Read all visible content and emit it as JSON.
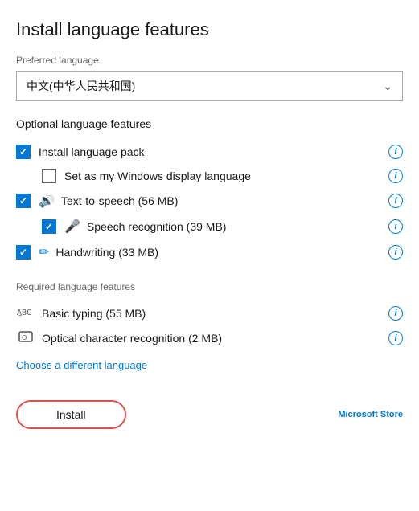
{
  "page": {
    "title": "Install language features"
  },
  "preferred": {
    "label": "Preferred language",
    "selected": "中文(中华人民共和国)",
    "dropdown_placeholder": "中文(中华人民共和国)"
  },
  "optional": {
    "section_title": "Optional language features",
    "items": [
      {
        "id": "install-pack",
        "label": "Install language pack",
        "checked": true,
        "icon": null,
        "level": 0
      },
      {
        "id": "windows-display",
        "label": "Set as my Windows display language",
        "checked": false,
        "icon": null,
        "level": 1
      },
      {
        "id": "text-to-speech",
        "label": "Text-to-speech (56 MB)",
        "checked": true,
        "icon": "tts",
        "level": 0
      },
      {
        "id": "speech-recognition",
        "label": "Speech recognition (39 MB)",
        "checked": true,
        "icon": "mic",
        "level": 1
      },
      {
        "id": "handwriting",
        "label": "Handwriting (33 MB)",
        "checked": true,
        "icon": "pen",
        "level": 0
      }
    ]
  },
  "required": {
    "section_title": "Required language features",
    "items": [
      {
        "id": "basic-typing",
        "label": "Basic typing (55 MB)",
        "icon": "abc"
      },
      {
        "id": "ocr",
        "label": "Optical character recognition (2 MB)",
        "icon": "ocr"
      }
    ]
  },
  "choose_link": "Choose a different language",
  "buttons": {
    "install": "Install",
    "ms_store": "Microsoft Store"
  }
}
